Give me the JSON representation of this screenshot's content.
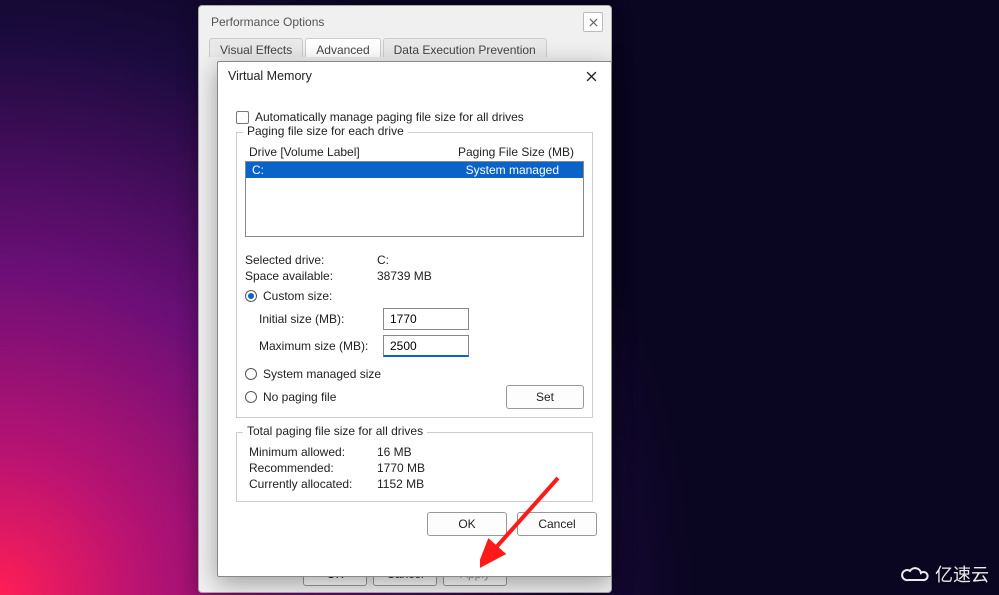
{
  "parent_dialog": {
    "title": "Performance Options",
    "tabs": [
      "Visual Effects",
      "Advanced",
      "Data Execution Prevention"
    ],
    "active_tab_index": 1,
    "buttons": {
      "ok": "OK",
      "cancel": "Cancel",
      "apply": "Apply"
    }
  },
  "dialog": {
    "title": "Virtual Memory",
    "auto_manage_label": "Automatically manage paging file size for all drives",
    "auto_manage_checked": false,
    "group_drives_label": "Paging file size for each drive",
    "list_headers": {
      "drive": "Drive  [Volume Label]",
      "size": "Paging File Size (MB)"
    },
    "drives": [
      {
        "name": "C:",
        "size_text": "System managed",
        "selected": true
      }
    ],
    "selected_drive_label": "Selected drive:",
    "selected_drive_value": "C:",
    "space_available_label": "Space available:",
    "space_available_value": "38739 MB",
    "option_custom_label": "Custom size:",
    "option_system_label": "System managed size",
    "option_none_label": "No paging file",
    "selected_option": "custom",
    "initial_label": "Initial size (MB):",
    "initial_value": "1770",
    "maximum_label": "Maximum size (MB):",
    "maximum_value": "2500",
    "set_button": "Set",
    "totals_label": "Total paging file size for all drives",
    "minimum_allowed_label": "Minimum allowed:",
    "minimum_allowed_value": "16 MB",
    "recommended_label": "Recommended:",
    "recommended_value": "1770 MB",
    "currently_allocated_label": "Currently allocated:",
    "currently_allocated_value": "1152 MB",
    "ok_button": "OK",
    "cancel_button": "Cancel"
  },
  "watermark": "亿速云"
}
